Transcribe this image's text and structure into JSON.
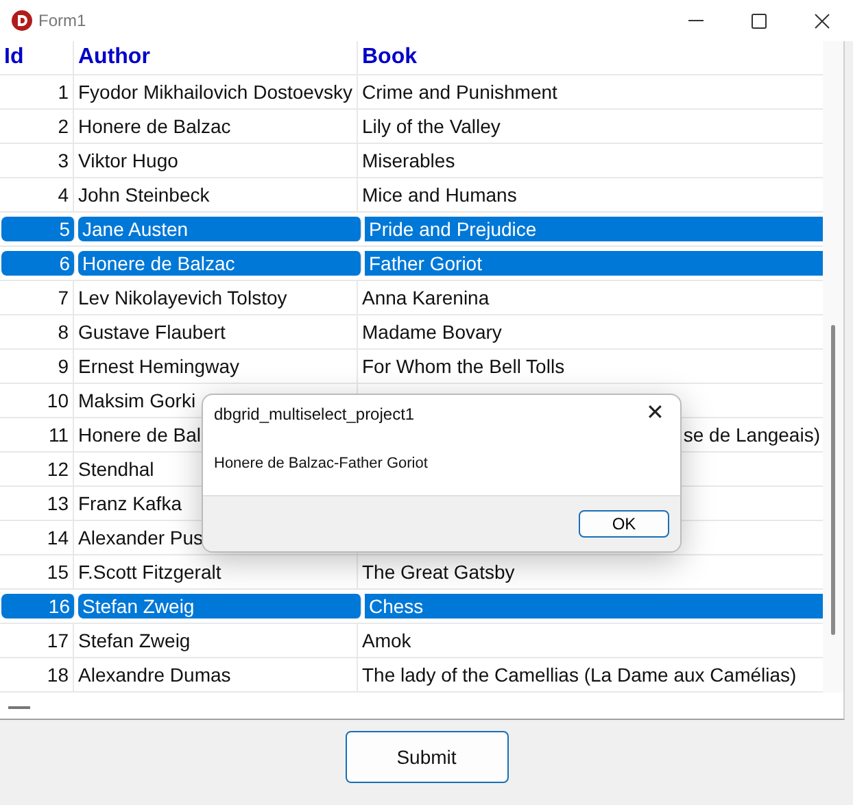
{
  "window": {
    "title": "Form1"
  },
  "table": {
    "columns": [
      "Id",
      "Author",
      "Book"
    ],
    "rows": [
      {
        "id": "1",
        "author": "Fyodor Mikhailovich Dostoevsky",
        "book": "Crime and Punishment",
        "selected": false
      },
      {
        "id": "2",
        "author": "Honere de Balzac",
        "book": "Lily of the Valley",
        "selected": false
      },
      {
        "id": "3",
        "author": "Viktor Hugo",
        "book": "Miserables",
        "selected": false
      },
      {
        "id": "4",
        "author": "John Steinbeck",
        "book": "Mice and Humans",
        "selected": false
      },
      {
        "id": "5",
        "author": "Jane Austen",
        "book": "Pride and Prejudice",
        "selected": true
      },
      {
        "id": "6",
        "author": "Honere de Balzac",
        "book": "Father Goriot",
        "selected": true
      },
      {
        "id": "7",
        "author": "Lev Nikolayevich Tolstoy",
        "book": "Anna Karenina",
        "selected": false
      },
      {
        "id": "8",
        "author": "Gustave Flaubert",
        "book": "Madame Bovary",
        "selected": false
      },
      {
        "id": "9",
        "author": "Ernest Hemingway",
        "book": "For Whom the Bell Tolls",
        "selected": false
      },
      {
        "id": "10",
        "author": "Maksim Gorki",
        "selected": false
      },
      {
        "id": "11",
        "author": "Honere de Bal",
        "book": "se de Langeais)",
        "book_cut_left": true,
        "selected": false
      },
      {
        "id": "12",
        "author": "Stendhal",
        "selected": false
      },
      {
        "id": "13",
        "author": "Franz Kafka",
        "selected": false
      },
      {
        "id": "14",
        "author": "Alexander Pus",
        "selected": false
      },
      {
        "id": "15",
        "author": "F.Scott Fitzgeralt",
        "book": "The Great Gatsby",
        "selected": false
      },
      {
        "id": "16",
        "author": "Stefan Zweig",
        "book": "Chess",
        "selected": true
      },
      {
        "id": "17",
        "author": "Stefan Zweig",
        "book": "Amok",
        "selected": false
      },
      {
        "id": "18",
        "author": "Alexandre Dumas",
        "book": "The lady of the Camellias (La Dame aux Camélias)",
        "selected": false
      }
    ]
  },
  "buttons": [
    "Submit"
  ],
  "dialog": {
    "title": "dbgrid_multiselect_project1",
    "close": "✕",
    "message": "Honere de Balzac-Father Goriot",
    "button": "OK"
  }
}
